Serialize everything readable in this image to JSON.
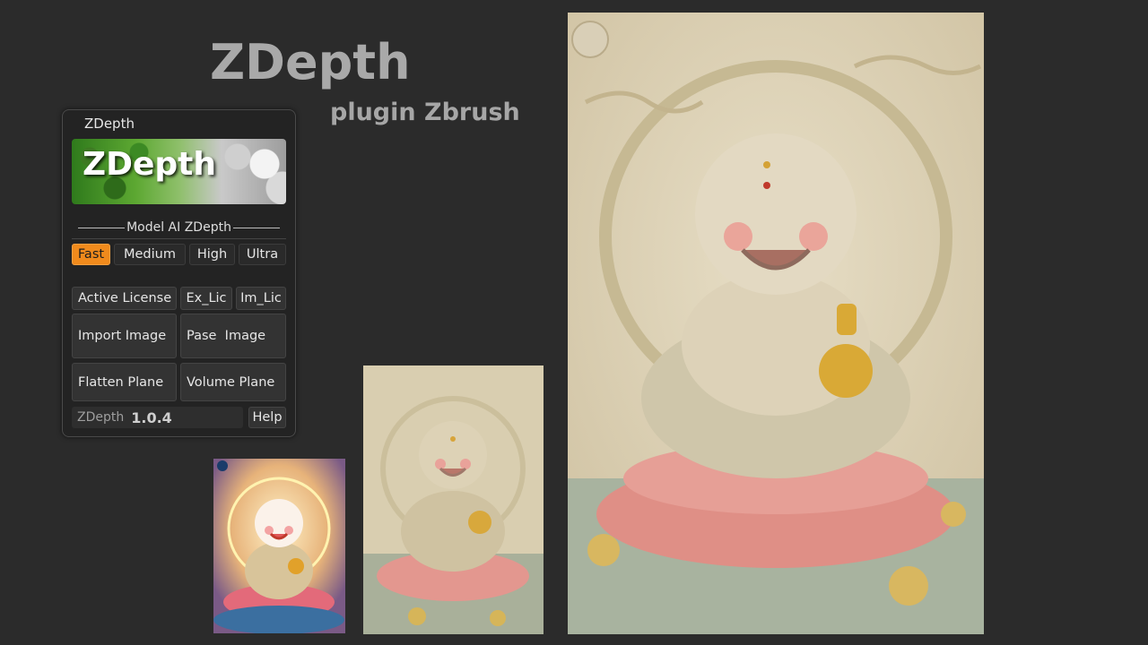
{
  "hero": {
    "title": "ZDepth",
    "subtitle": "plugin Zbrush"
  },
  "panel": {
    "title": "ZDepth",
    "banner_text": "ZDepth",
    "section_label": "Model AI ZDepth",
    "model_buttons": [
      {
        "label": "Fast",
        "active": true
      },
      {
        "label": "Medium",
        "active": false
      },
      {
        "label": "High",
        "active": false
      },
      {
        "label": "Ultra",
        "active": false
      }
    ],
    "license": {
      "active": "Active License",
      "export": "Ex_Lic",
      "import": "Im_Lic"
    },
    "actions": {
      "import_image": "Import Image",
      "paste_image": "Pase  Image",
      "flatten_plane": "Flatten Plane",
      "volume_plane": "Volume Plane"
    },
    "footer": {
      "name": "ZDepth",
      "version": "1.0.4",
      "help": "Help"
    }
  },
  "colors": {
    "accent": "#f08a1c",
    "background": "#2b2b2b",
    "panel": "#232323"
  }
}
